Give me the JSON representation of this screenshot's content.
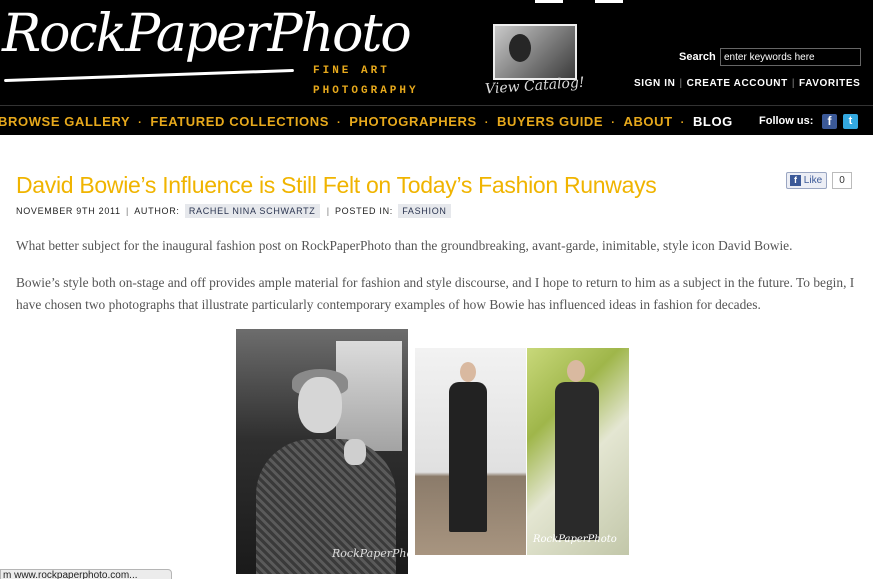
{
  "header": {
    "logo_text": "RockPaperPhoto",
    "tagline_line1": "FINE ART",
    "tagline_line2": "PHOTOGRAPHY",
    "catalog_label": "View Catalog!",
    "search": {
      "label": "Search",
      "value": "enter keywords here"
    },
    "account_links": [
      "SIGN IN",
      "CREATE ACCOUNT",
      "FAVORITES"
    ]
  },
  "nav": {
    "items": [
      "BROWSE GALLERY",
      "FEATURED COLLECTIONS",
      "PHOTOGRAPHERS",
      "BUYERS GUIDE",
      "ABOUT",
      "BLOG"
    ],
    "follow_label": "Follow us:",
    "social": [
      {
        "name": "facebook",
        "glyph": "f",
        "color": "#3b5998"
      },
      {
        "name": "twitter",
        "glyph": "t",
        "color": "#33a8e0"
      }
    ]
  },
  "article": {
    "title": "David Bowie’s Influence is Still Felt on Today’s Fashion Runways",
    "like_label": "Like",
    "like_count": "0",
    "date": "NOVEMBER 9TH 2011",
    "author_label": "AUTHOR:",
    "author": "RACHEL NINA SCHWARTZ",
    "posted_label": "POSTED IN:",
    "category": "FASHION",
    "paragraphs": [
      "What better subject for the inaugural fashion post on RockPaperPhoto than the groundbreaking, avant-garde, inimitable, style icon David Bowie.",
      "Bowie’s style both on-stage and off provides ample material for fashion and style discourse, and I hope to return to him as a subject in the future. To begin, I have chosen two photographs that illustrate particularly contemporary examples of how Bowie has influenced ideas in fashion for decades."
    ],
    "photo_watermark": "RockPaperPhoto"
  },
  "status_bar": {
    "text": "m www.rockpaperphoto.com..."
  },
  "colors": {
    "accent": "#e7a91c",
    "title": "#f0b400",
    "header_bg": "#000000"
  }
}
